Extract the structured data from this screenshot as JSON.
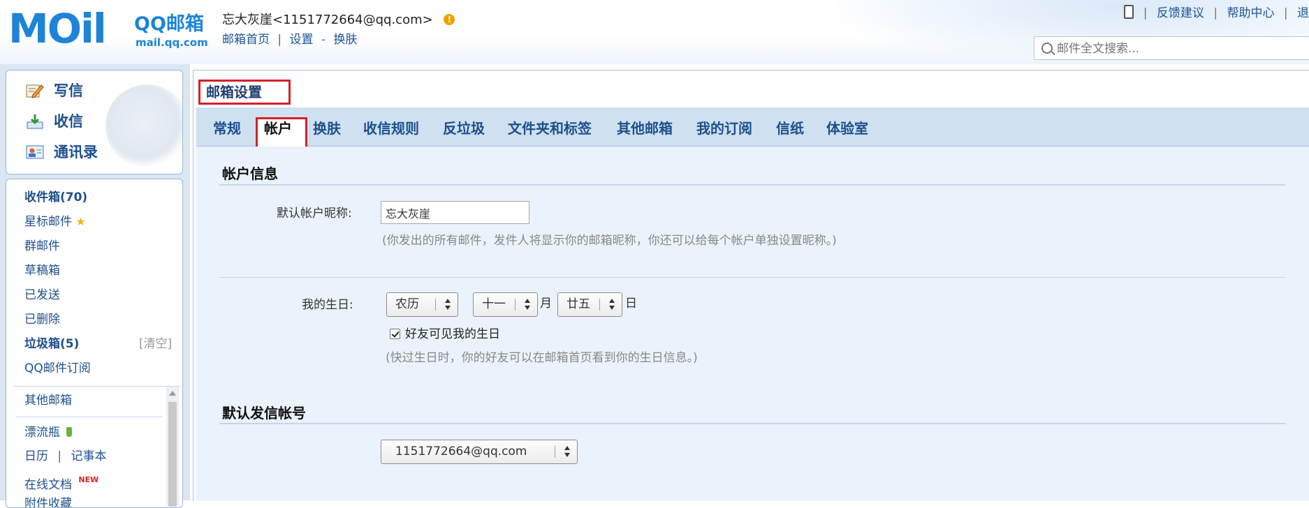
{
  "header": {
    "logo": {
      "mail_word": "MOil",
      "brand_cn": "QQ邮箱",
      "brand_url": "mail.qq.com"
    },
    "user": {
      "display": "忘大灰崖<1151772664@qq.com>",
      "warning_glyph": "!"
    },
    "links": {
      "home": "邮箱首页",
      "settings": "设置",
      "dash": "-",
      "skin": "换肤"
    },
    "top_right": {
      "feedback": "反馈建议",
      "help": "帮助中心",
      "logout": "退"
    },
    "search": {
      "placeholder": "邮件全文搜索..."
    }
  },
  "sidebar": {
    "quick": {
      "compose": "写信",
      "inbox": "收信",
      "contacts": "通讯录"
    },
    "folders": {
      "inbox": "收件箱(70)",
      "starred": "星标邮件",
      "groups": "群邮件",
      "drafts": "草稿箱",
      "sent": "已发送",
      "deleted": "已删除",
      "spam": "垃圾箱(5)",
      "spam_clear": "[清空]",
      "subscriptions": "QQ邮件订阅",
      "other_mailbox": "其他邮箱",
      "drift_bottle": "漂流瓶",
      "calendar": "日历",
      "pipe": "|",
      "notepad": "记事本",
      "online_docs": "在线文档",
      "new_tag": "NEW",
      "attachments": "附件收藏"
    }
  },
  "main": {
    "title": "邮箱设置",
    "tabs": [
      "常规",
      "帐户",
      "换肤",
      "收信规则",
      "反垃圾",
      "文件夹和标签",
      "其他邮箱",
      "我的订阅",
      "信纸",
      "体验室"
    ],
    "active_tab": "帐户",
    "account_info": {
      "section_title": "帐户信息",
      "nickname_label": "默认帐户昵称:",
      "nickname_value": "忘大灰崖",
      "nickname_hint": "(你发出的所有邮件，发件人将显示你的邮箱昵称，你还可以给每个帐户单独设置昵称。)",
      "birthday_label": "我的生日:",
      "calendar_type": "农历",
      "month": "十一",
      "month_unit": "月",
      "day": "廿五",
      "day_unit": "日",
      "birthday_visible_label": "好友可见我的生日",
      "birthday_visible_checked": true,
      "birthday_hint": "(快过生日时，你的好友可以在邮箱首页看到你的生日信息。)"
    },
    "default_sender": {
      "section_title": "默认发信帐号",
      "address": "1151772664@qq.com"
    }
  },
  "colors": {
    "accent_blue": "#1e4f8c",
    "logo_blue": "#1d84d8",
    "highlight_red": "#d4202a",
    "tab_bar": "#cfe0f1",
    "content_bg": "#eaf2fb"
  }
}
